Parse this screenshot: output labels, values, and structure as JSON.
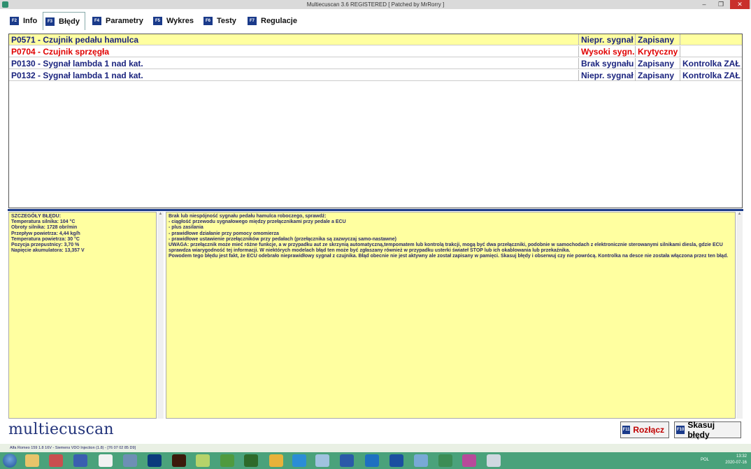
{
  "window": {
    "title": "Multiecuscan 3.6 REGISTERED    [ Patched by MrRorry ]",
    "min": "–",
    "max": "❐",
    "close": "✕"
  },
  "tabs": [
    {
      "key": "F2",
      "label": "Info"
    },
    {
      "key": "F3",
      "label": "Błędy"
    },
    {
      "key": "F4",
      "label": "Parametry"
    },
    {
      "key": "F5",
      "label": "Wykres"
    },
    {
      "key": "F6",
      "label": "Testy"
    },
    {
      "key": "F7",
      "label": "Regulacje"
    }
  ],
  "faults": [
    {
      "code": "P0571 - Czujnik pedału hamulca",
      "type": "Niepr. sygnał",
      "status": "Zapisany",
      "lamp": ""
    },
    {
      "code": "P0704 - Czujnik sprzęgła",
      "type": "Wysoki sygn.",
      "status": "Krytyczny",
      "lamp": ""
    },
    {
      "code": "P0130 - Sygnał lambda 1 nad kat.",
      "type": "Brak sygnału",
      "status": "Zapisany",
      "lamp": "Kontrolka ZAŁ"
    },
    {
      "code": "P0132 - Sygnał lambda 1 nad kat.",
      "type": "Niepr. sygnał",
      "status": "Zapisany",
      "lamp": "Kontrolka ZAŁ"
    }
  ],
  "details": {
    "lines": [
      "SZCZEGÓŁY BŁĘDU:",
      "Temperatura silnika: 104 °C",
      "Obroty silnika: 1728 obr/min",
      "Przepływ powietrza: 4,44 kg/h",
      "Temperatura powietrza: 30 °C",
      "Pozycja przepustnicy: 3,70 %",
      "Napięcie akumulatora: 13,357 V"
    ]
  },
  "description": {
    "lines": [
      "Brak lub niespójność sygnału pedału hamulca roboczego, sprawdź:",
      "- ciągłość przewodu sygnałowego między przełącznikami przy pedale a ECU",
      "- plus zasilania",
      "- prawidłowe działanie przy pomocy omomierza",
      "- prawidłowe ustawienie przełączników przy pedałach (przełącznika są zazwyczaj samo-nastawne)",
      "UWAGA: przełącznik może mieć różne funkcje, a w przypadku aut ze skrzynią automatyczną,tempomatem lub kontrolą trakcji, mogą być dwa przełączniki, podobnie w samochodach z elektronicznie sterowanymi silnikami diesla, gdzie ECU sprawdza wiarygodność tej informacji. W niektórych modelach błąd ten może być zgłaszany również w przypadku usterki świateł STOP lub ich okablowania lub przekaźnika.",
      "Powodem tego błędu jest fakt, że ECU odebrało nieprawidłowy sygnał z czujnika. Błąd obecnie nie jest aktywny ale został zapisany w pamięci. Skasuj błędy i obserwuj czy nie powrócą. Kontrolka na desce nie została włączona przez ten błąd."
    ]
  },
  "logo": "multiecuscan",
  "buttons": {
    "disconnect": {
      "key": "F11",
      "label": "Rozłącz"
    },
    "clear": {
      "key": "F10",
      "label": "Skasuj błędy"
    }
  },
  "status_line": "Alfa Romeo 159 1.8 16V - Siemens VDO Injection (1.8) - [76 07 02 85 D9]",
  "taskbar": {
    "lang": "POL",
    "time": "13:32",
    "date": "2020-07-16"
  },
  "colors": {
    "selected_row": "#ffffa0",
    "critical_text": "#e00000",
    "normal_text": "#1a237e",
    "taskbar": "#4aa27b"
  }
}
